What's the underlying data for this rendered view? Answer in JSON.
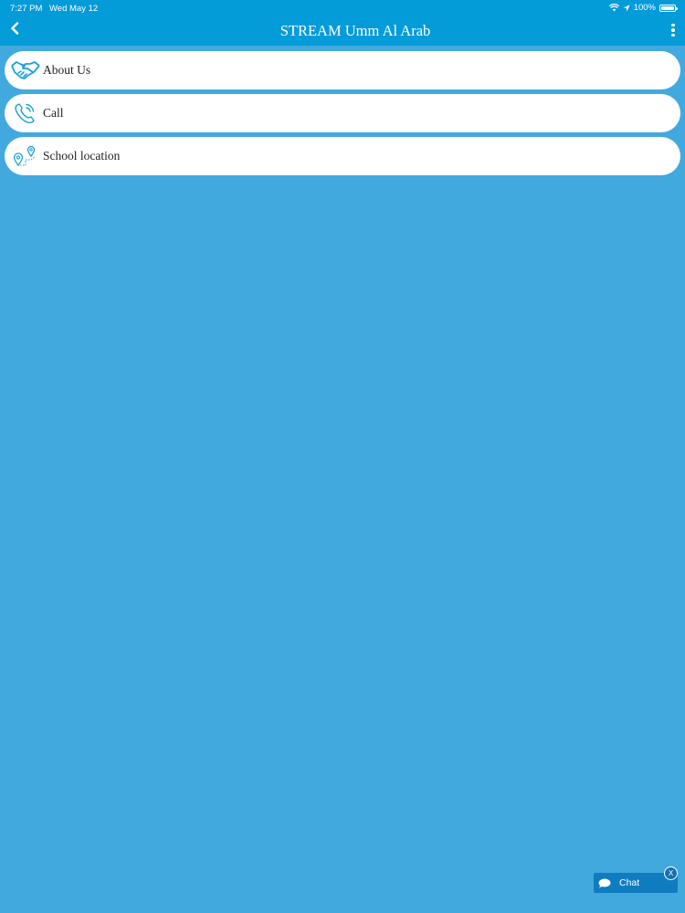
{
  "status_bar": {
    "time": "7:27 PM",
    "date": "Wed May 12",
    "battery": "100%",
    "icons": [
      "wifi-icon",
      "location-arrow-icon",
      "battery-icon"
    ]
  },
  "header": {
    "title": "STREAM Umm Al Arab",
    "back_icon": "chevron-left-icon",
    "more_icon": "vertical-ellipsis-icon"
  },
  "menu": {
    "items": [
      {
        "label": "About Us",
        "icon": "handshake-icon"
      },
      {
        "label": "Call",
        "icon": "phone-icon"
      },
      {
        "label": "School location",
        "icon": "map-pin-route-icon"
      }
    ]
  },
  "chat": {
    "label": "Chat",
    "close_label": "X",
    "icon": "chat-bubble-icon"
  },
  "colors": {
    "background": "#42a9de",
    "header": "#049bd9",
    "icon_accent": "#1aa0d8",
    "chat": "#0f7cc0"
  }
}
